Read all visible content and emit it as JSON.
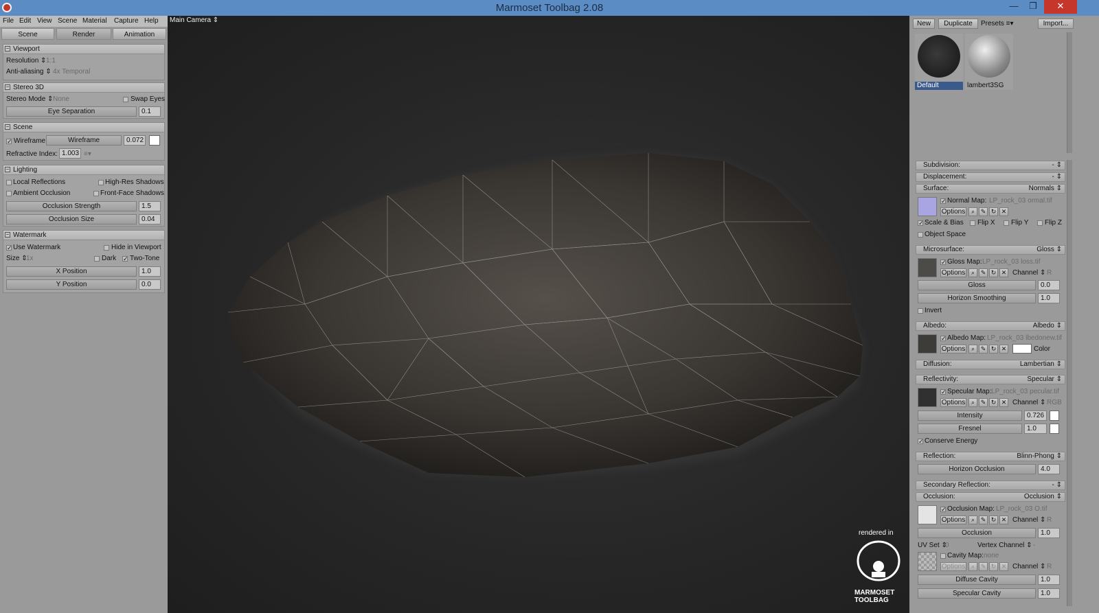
{
  "window": {
    "title": "Marmoset Toolbag 2.08",
    "minimize": "—",
    "maximize": "❐",
    "close": "✕"
  },
  "menu": [
    "File",
    "Edit",
    "View",
    "Scene",
    "Material",
    "Capture",
    "Help"
  ],
  "camera": {
    "label": "Main Camera ⇕"
  },
  "tabs": [
    "Scene",
    "Render",
    "Animation"
  ],
  "left": {
    "viewport": {
      "title": "Viewport",
      "resolution_label": "Resolution ⇕",
      "resolution_value": "1:1",
      "aa_label": "Anti-aliasing ⇕",
      "aa_value": "4x Temporal"
    },
    "stereo": {
      "title": "Stereo 3D",
      "mode_label": "Stereo Mode ⇕",
      "mode_value": "None",
      "swap": "Swap Eyes",
      "eye_sep": "Eye Separation",
      "eye_sep_val": "0.1"
    },
    "scene": {
      "title": "Scene",
      "wireframe": "Wireframe",
      "wireframe_slider": "Wireframe",
      "wireframe_val": "0.072",
      "refractive_label": "Refractive Index:",
      "refractive_val": "1.003",
      "menu_icon": "≡▾"
    },
    "lighting": {
      "title": "Lighting",
      "local_refl": "Local Reflections",
      "hires": "High-Res Shadows",
      "ao": "Ambient Occlusion",
      "ffs": "Front-Face Shadows",
      "occ_strength": "Occlusion Strength",
      "occ_strength_val": "1.5",
      "occ_size": "Occlusion Size",
      "occ_size_val": "0.04"
    },
    "watermark": {
      "title": "Watermark",
      "use": "Use Watermark",
      "hide": "Hide in Viewport",
      "size_label": "Size ⇕",
      "size_value": "1x",
      "dark": "Dark",
      "two_tone": "Two-Tone",
      "xpos": "X Position",
      "xpos_val": "1.0",
      "ypos": "Y Position",
      "ypos_val": "0.0"
    }
  },
  "viewport": {
    "rendered_in": "rendered in",
    "logo_text_1": "MARMOSET",
    "logo_text_2": "TOOLBAG"
  },
  "right": {
    "buttons": {
      "new": "New",
      "duplicate": "Duplicate",
      "presets": "Presets ≡▾",
      "import": "Import..."
    },
    "materials": [
      {
        "name": "Default"
      },
      {
        "name": "lambert3SG"
      }
    ],
    "subdivision": {
      "title": "Subdivision:",
      "value": "- ⇕"
    },
    "displacement": {
      "title": "Displacement:",
      "value": "- ⇕"
    },
    "surface": {
      "title": "Surface:",
      "value": "Normals ⇕",
      "map_label": "Normal Map:",
      "map_file": "LP_rock_03 ormal.tif",
      "options": "Options",
      "scale_bias": "Scale & Bias",
      "flipx": "Flip X",
      "flipy": "Flip Y",
      "flipz": "Flip Z",
      "object_space": "Object Space"
    },
    "microsurface": {
      "title": "Microsurface:",
      "value": "Gloss ⇕",
      "map_label": "Gloss Map:",
      "map_file": "LP_rock_03 loss.tif",
      "options": "Options",
      "channel": "Channel ⇕",
      "channel_val": "R",
      "gloss": "Gloss",
      "gloss_val": "0.0",
      "horizon": "Horizon Smoothing",
      "horizon_val": "1.0",
      "invert": "Invert"
    },
    "albedo": {
      "title": "Albedo:",
      "value": "Albedo ⇕",
      "map_label": "Albedo Map:",
      "map_file": "LP_rock_03 lbedonew.tif",
      "options": "Options",
      "color": "Color"
    },
    "diffusion": {
      "title": "Diffusion:",
      "value": "Lambertian ⇕"
    },
    "reflectivity": {
      "title": "Reflectivity:",
      "value": "Specular ⇕",
      "map_label": "Specular Map:",
      "map_file": "LP_rock_03 pecular.tif",
      "options": "Options",
      "channel": "Channel ⇕",
      "channel_val": "RGB",
      "intensity": "Intensity",
      "intensity_val": "0.726",
      "fresnel": "Fresnel",
      "fresnel_val": "1.0",
      "conserve": "Conserve Energy"
    },
    "reflection": {
      "title": "Reflection:",
      "value": "Blinn-Phong ⇕",
      "horizon_occ": "Horizon Occlusion",
      "horizon_occ_val": "4.0"
    },
    "secondary": {
      "title": "Secondary Reflection:",
      "value": "- ⇕"
    },
    "occlusion": {
      "title": "Occlusion:",
      "value": "Occlusion ⇕",
      "map_label": "Occlusion Map:",
      "map_file": "LP_rock_03 O.tif",
      "options": "Options",
      "channel": "Channel ⇕",
      "channel_val": "R",
      "occ": "Occlusion",
      "occ_val": "1.0",
      "uvset": "UV Set ⇕",
      "uvset_val": "0",
      "vertex_channel": "Vertex Channel ⇕",
      "vertex_channel_val": "-",
      "cavity_label": "Cavity Map:",
      "cavity_file": "none",
      "diffuse_cavity": "Diffuse Cavity",
      "diffuse_cavity_val": "1.0",
      "specular_cavity": "Specular Cavity",
      "specular_cavity_val": "1.0"
    }
  }
}
